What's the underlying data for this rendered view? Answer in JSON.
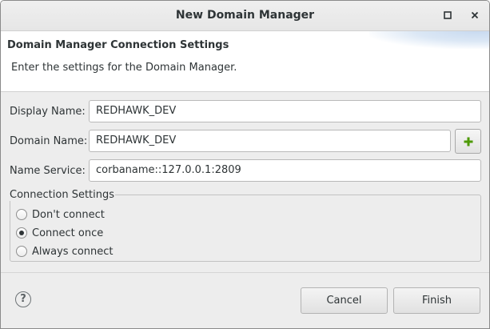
{
  "window": {
    "title": "New Domain Manager",
    "maximize_icon": "maximize-icon",
    "close_icon": "close-icon"
  },
  "banner": {
    "title": "Domain Manager Connection Settings",
    "description": "Enter the settings for the Domain Manager."
  },
  "form": {
    "display_name_label": "Display Name:",
    "display_name_value": "REDHAWK_DEV",
    "domain_name_label": "Domain Name:",
    "domain_name_value": "REDHAWK_DEV",
    "name_service_label": "Name Service:",
    "name_service_value": "corbaname::127.0.0.1:2809",
    "add_icon": "plus-icon",
    "add_icon_color": "#4e9a06"
  },
  "connection": {
    "group_label": "Connection Settings",
    "options": [
      {
        "label": "Don't connect",
        "selected": false
      },
      {
        "label": "Connect once",
        "selected": true
      },
      {
        "label": "Always connect",
        "selected": false
      }
    ]
  },
  "footer": {
    "help_icon": "help-icon",
    "help_glyph": "?",
    "cancel_label": "Cancel",
    "finish_label": "Finish"
  }
}
